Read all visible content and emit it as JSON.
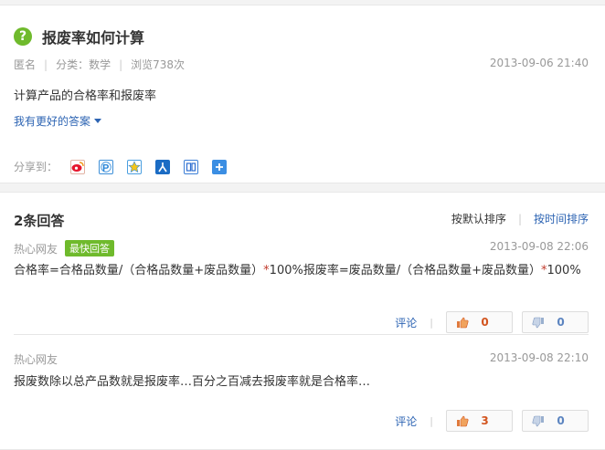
{
  "question": {
    "title": "报废率如何计算",
    "author": "匿名",
    "category": "分类：数学",
    "views": "浏览738次",
    "date": "2013-09-06 21:40",
    "body": "计算产品的合格率和报废率",
    "better_answer_link": "我有更好的答案",
    "share_label": "分享到："
  },
  "answers_header": {
    "count": "2条回答",
    "sort_default": "按默认排序",
    "sort_time": "按时间排序"
  },
  "answers": [
    {
      "author": "热心网友",
      "badge": "最快回答",
      "date": "2013-09-08 22:06",
      "text_a": "合格率=合格品数量/（合格品数量+废品数量）",
      "star1": "*",
      "text_b": "100%报废率=废品数量/（合格品数量+废品数量）",
      "star2": "*",
      "text_c": "100%",
      "comment_label": "评论",
      "upvotes": "0",
      "downvotes": "0"
    },
    {
      "author": "热心网友",
      "date": "2013-09-08 22:10",
      "text": "报废数除以总产品数就是报废率…百分之百减去报废率就是合格率…",
      "comment_label": "评论",
      "upvotes": "3",
      "downvotes": "0"
    }
  ],
  "colors": {
    "accent_green": "#6fba2c",
    "link_blue": "#2d64b3",
    "upvote_red": "#d2541e"
  },
  "share_icons": [
    "weibo-icon",
    "qzone-icon",
    "qq-icon",
    "renren-icon",
    "tieba-icon",
    "more-share-icon"
  ]
}
